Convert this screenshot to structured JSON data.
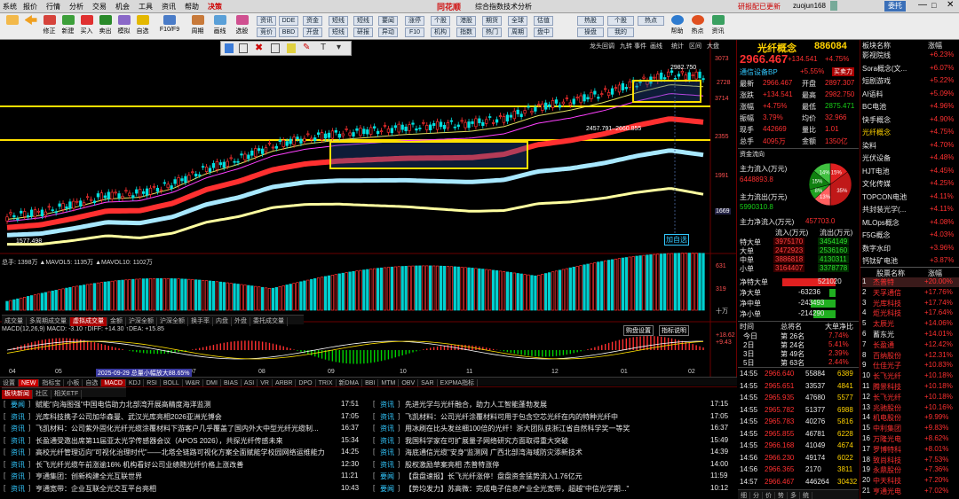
{
  "menu": {
    "items": [
      "系统",
      "报价",
      "行情",
      "分析",
      "交易",
      "机会",
      "工具",
      "资讯",
      "帮助",
      "决策"
    ],
    "right_user": "研报配已更新",
    "username": "zuojun168",
    "account": "委托"
  },
  "app": {
    "logo": "同花顺",
    "title": "综合指数技术分析"
  },
  "toolbar": {
    "left": [
      "",
      "修正",
      "新建",
      "买入",
      "卖出",
      "模拟",
      "自选",
      "F10/F9",
      "周期",
      "画线",
      "选股"
    ],
    "chips": [
      "资讯",
      "竞价",
      "DDE",
      "BBD",
      "资金",
      "开盘",
      "短线",
      "短线",
      "短线",
      "研报",
      "要闻",
      "异动",
      "涨停",
      "F10",
      "个股",
      "机构",
      "港股",
      "指数",
      "期货",
      "热门",
      "全球",
      "周期",
      "估值",
      "盘中"
    ],
    "right": [
      "热股",
      "操盘",
      "个股",
      "我的",
      "热点"
    ],
    "help": [
      "帮助",
      "热点",
      "资讯"
    ]
  },
  "chart": {
    "tag": "龙头回调",
    "tabs": [
      "九转",
      "事件",
      "画线",
      "统计",
      "区间",
      "大盘"
    ],
    "crosshair_label": "加自选",
    "price_labels": [
      "2982.750",
      "2457.791–2660.855",
      "1577.498"
    ],
    "axis_labels": [
      "3073",
      "2728",
      "3714",
      "2355",
      "1991",
      "1669"
    ],
    "vol_header": "总手: 1398万 ▲MAVOL5: 1135万 ▲MAVOL10: 1102万",
    "vol_axis": [
      "631",
      "319",
      "十万"
    ],
    "macd_header": "MACD(12,26,9) MACD: -3.10 ↑DIFF: +14.30 ↑DEA: +15.85",
    "macd_axis": [
      "+18.62",
      "+9.43"
    ],
    "macd_btns": [
      "购盘设置",
      "指标说明"
    ],
    "period_tabs": [
      "成交量",
      "多周期成交量",
      "虚拟成交量",
      "金额",
      "沪深全额",
      "沪深全额",
      "换手率",
      "内盘",
      "外盘",
      "委托成交量"
    ],
    "x_labels": [
      "04",
      "05",
      "06",
      "07",
      "08",
      "09",
      "10",
      "11",
      "12",
      "01",
      "02"
    ],
    "date_note": "2025-09-29 总量小幅放大88.65%",
    "indicator_tabs": [
      "设置",
      "NEW",
      "指标宝",
      "小板",
      "自选",
      "MACD",
      "KDJ",
      "RSI",
      "BOLL",
      "W&R",
      "DMI",
      "BIAS",
      "ASI",
      "VR",
      "ARBR",
      "DPO",
      "TRIX",
      "新DMA",
      "BBI",
      "MTM",
      "OBV",
      "SAR",
      "EXPMA指标"
    ],
    "series": {
      "name": "光纤概念",
      "values": [
        1577.498,
        1620,
        1700,
        1790,
        1810,
        1900,
        2050,
        2150,
        2280,
        2355,
        2400,
        2430,
        2460,
        2480,
        2500,
        2550,
        2660,
        2720,
        2800,
        2900,
        2982.75,
        2966.467
      ]
    }
  },
  "quote": {
    "name": "光纤概念",
    "code": "886084",
    "price": "2966.467",
    "change": "+134.541",
    "pct": "+4.75%",
    "flag1": "通信设备BP",
    "flag1_pct": "+5.55%",
    "flag2": "买卖力",
    "rows": [
      [
        "最新",
        "2966.467",
        "开盘",
        "2897.307"
      ],
      [
        "涨跌",
        "+134.541",
        "最高",
        "2982.750"
      ],
      [
        "涨幅",
        "+4.75%",
        "最低",
        "2875.471"
      ],
      [
        "振幅",
        "3.79%",
        "均价",
        "32.966"
      ],
      [
        "现手",
        "442669",
        "量比",
        "1.01"
      ],
      [
        "总手",
        "4095万",
        "金额",
        "1350亿"
      ]
    ]
  },
  "flow": {
    "title": "资金流向",
    "in_label": "主力流入(万元)",
    "in_val": "6448893.8",
    "out_label": "主力流出(万元)",
    "out_val": "5990310.8",
    "net_label": "主力净流入(万元)",
    "net_val": "457703.0",
    "pie": [
      "15%",
      "35%",
      "13%",
      "8%",
      "15%",
      "14%"
    ],
    "headers": [
      "",
      "流入(万元)",
      "",
      "流出(万元)"
    ],
    "rows": [
      [
        "特大单",
        "3975170",
        "",
        "3454149"
      ],
      [
        "大单",
        "2472923",
        "",
        "2536160"
      ],
      [
        "中单",
        "3886818",
        "",
        "4130311"
      ],
      [
        "小单",
        "3164407",
        "",
        "3378778"
      ]
    ],
    "net": [
      [
        "净特大单",
        "521020"
      ],
      [
        "净大单",
        "-63236"
      ],
      [
        "净中单",
        "-243493"
      ],
      [
        "净小单",
        "-214290"
      ]
    ]
  },
  "days": {
    "headers": [
      "时间",
      "总将名",
      "大单净比"
    ],
    "rows": [
      [
        "今日",
        "第 26名",
        "7.74%"
      ],
      [
        "2日",
        "第 24名",
        "5.41%"
      ],
      [
        "3日",
        "第 49名",
        "2.39%"
      ],
      [
        "5日",
        "第 63名",
        "2.44%"
      ]
    ]
  },
  "ticks": [
    [
      "14:55",
      "2966.640",
      "55884",
      "6389"
    ],
    [
      "14:55",
      "2965.651",
      "33537",
      "4841"
    ],
    [
      "14:55",
      "2965.935",
      "47680",
      "5577"
    ],
    [
      "14:55",
      "2965.782",
      "51377",
      "6988"
    ],
    [
      "14:55",
      "2965.783",
      "40276",
      "5816"
    ],
    [
      "14:55",
      "2965.855",
      "46781",
      "6228"
    ],
    [
      "14:55",
      "2966.168",
      "41049",
      "4674"
    ],
    [
      "14:56",
      "2966.230",
      "49174",
      "6022"
    ],
    [
      "14:56",
      "2966.365",
      "2170",
      "3811"
    ],
    [
      "14:57",
      "2966.467",
      "446264",
      "30432"
    ]
  ],
  "ticks_tabs": [
    "细",
    "分",
    "价",
    "势",
    "多",
    "统"
  ],
  "sectors": {
    "header": [
      "板块名称",
      "涨幅"
    ],
    "rows": [
      [
        "影视院线",
        "+6.23%"
      ],
      [
        "Sora概念(文...",
        "+6.07%"
      ],
      [
        "短剧游戏",
        "+5.22%"
      ],
      [
        "AI语料",
        "+5.09%"
      ],
      [
        "BC电池",
        "+4.96%"
      ],
      [
        "快手概念",
        "+4.90%"
      ],
      [
        "光纤概念",
        "+4.75%"
      ],
      [
        "染料",
        "+4.70%"
      ],
      [
        "光伏设备",
        "+4.48%"
      ],
      [
        "HJT电池",
        "+4.45%"
      ],
      [
        "文化传媒",
        "+4.25%"
      ],
      [
        "TOPCON电池",
        "+4.11%"
      ],
      [
        "共封装光学(...",
        "+4.11%"
      ],
      [
        "MLOps概念",
        "+4.08%"
      ],
      [
        "F5G概念",
        "+4.03%"
      ],
      [
        "数字水印",
        "+3.96%"
      ],
      [
        "钙钛矿电池",
        "+3.87%"
      ]
    ]
  },
  "stocks": {
    "header": [
      "",
      "股票名称",
      "涨幅"
    ],
    "rows": [
      [
        "1",
        "杰普特",
        "+20.00%"
      ],
      [
        "2",
        "天孚通信",
        "+17.76%"
      ],
      [
        "3",
        "光库科技",
        "+17.74%"
      ],
      [
        "4",
        "炬光科技",
        "+17.64%"
      ],
      [
        "5",
        "太辰光",
        "+14.06%"
      ],
      [
        "6",
        "蓄东光",
        "+14.01%"
      ],
      [
        "7",
        "长盈通",
        "+12.42%"
      ],
      [
        "8",
        "百纳股份",
        "+12.31%"
      ],
      [
        "9",
        "仕佳光子",
        "+10.83%"
      ],
      [
        "10",
        "长飞光纤",
        "+10.18%"
      ],
      [
        "11",
        "腾景科技",
        "+10.18%"
      ],
      [
        "12",
        "长飞光纤",
        "+10.18%"
      ],
      [
        "13",
        "兆驰股份",
        "+10.16%"
      ],
      [
        "14",
        "机电股份",
        "+9.99%"
      ],
      [
        "15",
        "中利集团",
        "+9.83%"
      ],
      [
        "16",
        "万隆光电",
        "+8.62%"
      ],
      [
        "17",
        "罗博特科",
        "+8.01%"
      ],
      [
        "18",
        "致尚科技",
        "+7.53%"
      ],
      [
        "19",
        "永鼎股份",
        "+7.36%"
      ],
      [
        "20",
        "中天科技",
        "+7.20%"
      ],
      [
        "21",
        "亨通光电",
        "+7.02%"
      ]
    ]
  },
  "news": {
    "tabs": [
      "板块新闻",
      "社区",
      "相关ETF"
    ],
    "left": [
      [
        "要闻",
        "赋能\"向海图强\"中国电信助力北部湾开展高精度海洋监测",
        "17:51"
      ],
      [
        "资讯",
        "光库科技携子公司加华森曼、武汉光库亮相2026亚洲光博会",
        "17:05"
      ],
      [
        "资讯",
        "飞凯材料：公司紫外固化光纤光缆涂覆材料下游客户几乎覆盖了国内外大中型光纤光缆制...",
        "16:37"
      ],
      [
        "资讯",
        "长盈通受邀出席第11届亚太光学传感器会议（APOS 2026），共探光纤传感未来",
        "15:34"
      ],
      [
        "资讯",
        "高校光纤管理迈向\"可视化治理时代\"——北塔全链路可视化方案全面赋能学校园网络运维能力",
        "14:25"
      ],
      [
        "资讯",
        "长飞光纤光缆午前涨逾16% 机构看好公司业绩随光纤价格上涨改善",
        "12:30"
      ],
      [
        "资讯",
        "亨通集团：创新构建全光互联世界",
        "11:21"
      ],
      [
        "资讯",
        "亨通宽带：企业互联全光交互平台亮相",
        "10:43"
      ]
    ],
    "right": [
      [
        "资讯",
        "先进光学与光纤融合，助力人工智能蓬勃发展",
        "17:15"
      ],
      [
        "资讯",
        "飞凯材料：公司光纤涂覆材料可用于包含空芯光纤在内的特种光纤中",
        "17:05"
      ],
      [
        "资讯",
        "用冰刷在比头发丝细100倍的光纤！浙大团队获浙江省自然科学奖一等奖",
        "16:37"
      ],
      [
        "资讯",
        "我国科学家在可扩展量子网络研究方面取得重大突破",
        "15:49"
      ],
      [
        "资讯",
        "海底通信光缆\"安身\"监测网 广西北部湾海域防灾添新技术",
        "14:39"
      ],
      [
        "资讯",
        "股权激励草案亮相 杰普特涨停",
        "14:00"
      ],
      [
        "要闻",
        "【盘盘速报】长飞光纤涨停！盘盘资金猛势流入1.76亿元",
        "11:59"
      ],
      [
        "要闻",
        "【势均发力】苏高微：完成电子信息产业全光宽带，超越\"中信光学期...\"",
        "10:12"
      ]
    ]
  }
}
